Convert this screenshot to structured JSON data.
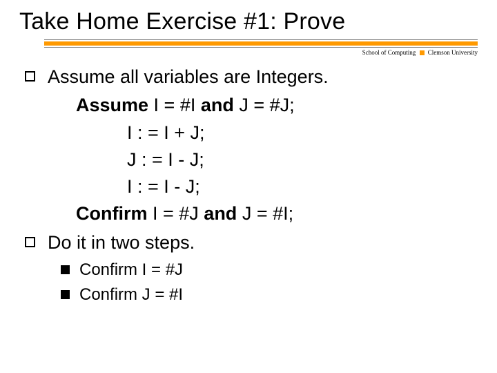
{
  "title": "Take Home Exercise #1: Prove",
  "affil": {
    "left": "School of Computing",
    "right": "Clemson University"
  },
  "b1": "Assume all variables are Integers.",
  "code": {
    "l1a": "Assume",
    "l1b": " I = #I ",
    "l1c": "and",
    "l1d": " J = #J;",
    "l2": "I : = I + J;",
    "l3": "J : = I - J;",
    "l4": "I : = I - J;",
    "l5a": "Confirm",
    "l5b": " I = #J ",
    "l5c": "and",
    "l5d": " J = #I;"
  },
  "b2": "Do it in two steps.",
  "s1": "Confirm I = #J",
  "s2": "Confirm J = #I"
}
